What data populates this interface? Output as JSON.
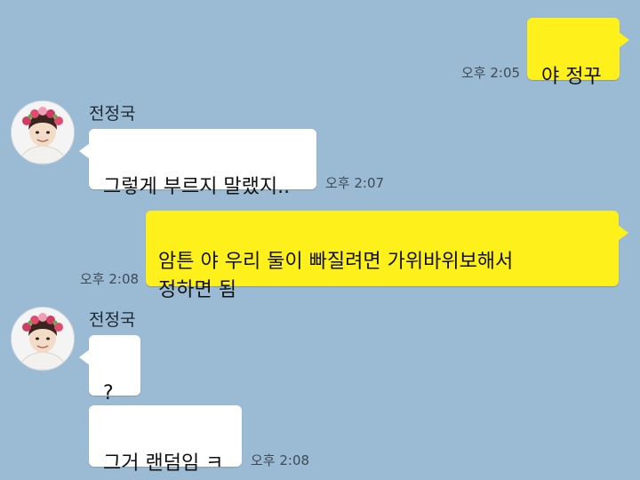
{
  "colors": {
    "background": "#9bbbd4",
    "my_bubble": "#fef01b",
    "their_bubble": "#ffffff"
  },
  "messages": [
    {
      "sender": "me",
      "text": "야 정꾸",
      "time": "오후 2:05"
    },
    {
      "sender": "전정국",
      "text": "그렇게 부르지 말랬지..",
      "time": "오후 2:07",
      "avatar_icon": "profile-photo-avatar"
    },
    {
      "sender": "me",
      "text": "암튼 야 우리 둘이 빠질려면 가위바위보해서\n정하면 됨",
      "time": "오후 2:08"
    },
    {
      "sender": "전정국",
      "text": "?",
      "avatar_icon": "profile-photo-avatar"
    },
    {
      "sender": "전정국",
      "text": "그거 랜덤임 ㅋ",
      "time": "오후 2:08"
    }
  ]
}
